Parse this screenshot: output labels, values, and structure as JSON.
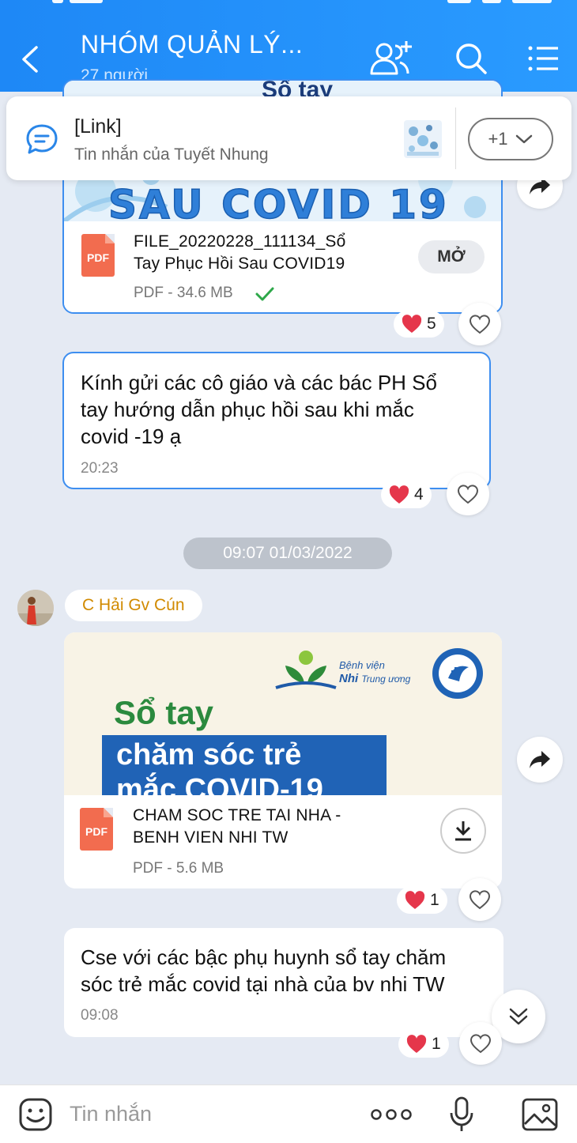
{
  "header": {
    "title": "NHÓM QUẢN LÝ...",
    "subtitle": "27 người"
  },
  "pinned": {
    "label": "[Link]",
    "sub": "Tin nhắn của Tuyết Nhung",
    "more": "+1"
  },
  "messages": {
    "file1": {
      "banner_text": "SAU COVID 19",
      "banner_top_text": "Sổ tay",
      "name_line1": "FILE_20220228_111134_Sổ",
      "name_line2": "Tay Phục Hồi Sau COVID19",
      "meta": "PDF - 34.6 MB",
      "open_label": "MỞ",
      "reaction_count": "5",
      "icon_label": "PDF"
    },
    "text1": {
      "line1": "Kính gửi các cô giáo và các bác PH Sổ",
      "line2": "tay hướng dẫn phục hồi sau khi mắc",
      "line3": "covid -19 ạ",
      "time": "20:23",
      "reaction_count": "4"
    },
    "date_separator": "09:07 01/03/2022",
    "sender": "C Hải Gv Cún",
    "file2": {
      "hospital_line1": "Bệnh viện",
      "hospital_line2_bold": "Nhi",
      "hospital_line2_rest": "Trung ương",
      "banner_title": "Sổ tay",
      "banner_line1": "chăm sóc trẻ",
      "banner_line2": "mắc COVID-19",
      "name_line1": "CHAM SOC TRE TAI NHA -",
      "name_line2": "BENH VIEN NHI TW",
      "meta": "PDF - 5.6 MB",
      "reaction_count": "1",
      "icon_label": "PDF"
    },
    "text2": {
      "line1": "Cse với các bậc phụ huynh sổ tay chăm",
      "line2": "sóc trẻ mắc covid tại nhà của bv nhi TW",
      "time": "09:08",
      "reaction_count": "1"
    }
  },
  "composer": {
    "placeholder": "Tin nhắn"
  },
  "colors": {
    "header": "#1e88f6",
    "background": "#e5eaf3",
    "selected_border": "#3d8ef0",
    "sender_name": "#d18a00",
    "pdf": "#f26c4f",
    "check": "#2ea84a",
    "heart": "#e5364b"
  },
  "icons": [
    "back-icon",
    "add-member-icon",
    "search-icon",
    "menu-icon",
    "chat-bubble-icon",
    "chevron-down-icon",
    "share-icon",
    "heart-icon",
    "download-icon",
    "check-icon",
    "scroll-down-icon",
    "sticker-icon",
    "more-icon",
    "mic-icon",
    "image-icon"
  ]
}
